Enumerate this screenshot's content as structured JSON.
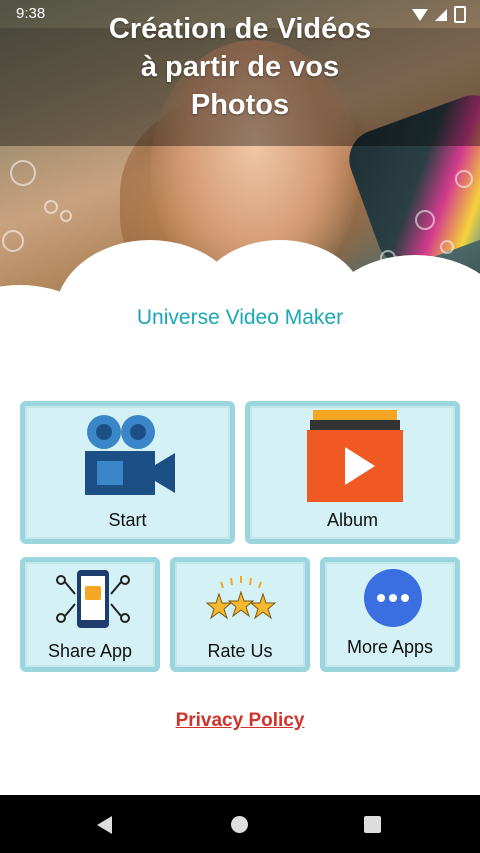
{
  "status_bar": {
    "time": "9:38"
  },
  "header": {
    "title_line1": "Création de Vidéos",
    "title_line2": "à partir de vos",
    "title_line3": "Photos"
  },
  "app_name": "Universe Video Maker",
  "menu": {
    "start_label": "Start",
    "album_label": "Album",
    "share_label": "Share App",
    "rate_label": "Rate Us",
    "more_label": "More Apps"
  },
  "privacy_label": "Privacy Policy",
  "colors": {
    "accent": "#1aa7b5",
    "card_bg": "#d4f1f5",
    "card_border": "#9bd5dd",
    "privacy": "#d0332b"
  },
  "icons": [
    "video-camera-icon",
    "album-play-icon",
    "share-phone-icon",
    "stars-icon",
    "more-dots-icon",
    "back-icon",
    "home-icon",
    "recents-icon",
    "wifi-icon",
    "signal-icon",
    "battery-icon"
  ]
}
